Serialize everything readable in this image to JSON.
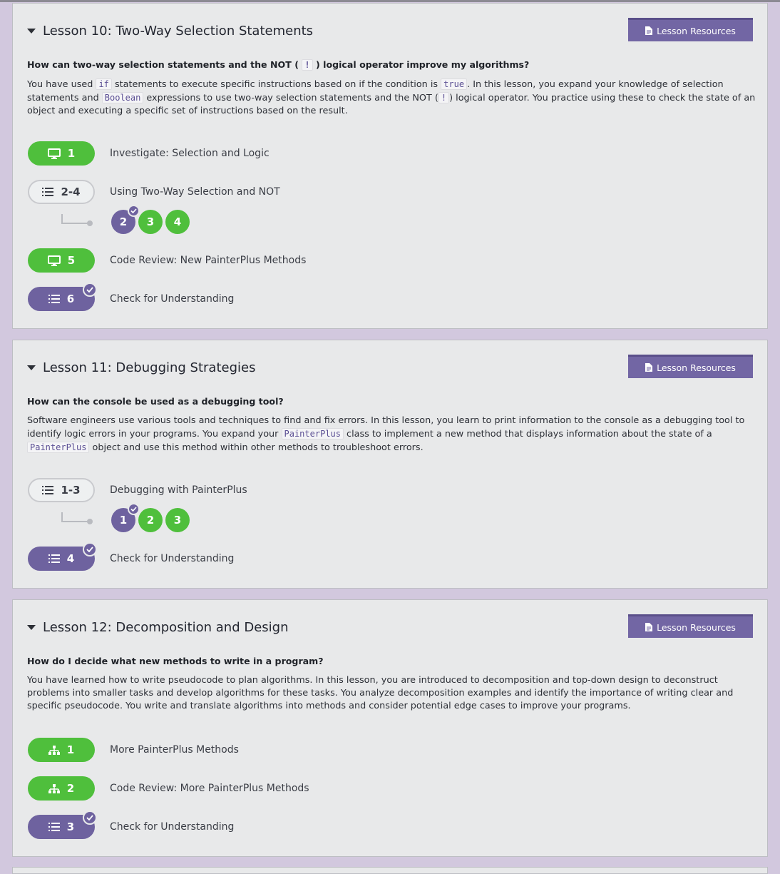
{
  "lessons": [
    {
      "title": "Lesson 10: Two-Way Selection Statements",
      "resources_label": "Lesson Resources",
      "question_before": "How can two-way selection statements and the NOT (",
      "question_code": "!",
      "question_after": ") logical operator improve my algorithms?",
      "desc": {
        "t1": "You have used ",
        "c1": "if",
        "t2": " statements to execute specific instructions based on if the condition is ",
        "c2": "true",
        "t3": ". In this lesson, you expand your knowledge of selection statements and ",
        "c3": "Boolean",
        "t4": " expressions to use two-way selection statements and the NOT (",
        "c4": "!",
        "t5": ") logical operator. You practice using these to check the state of an object and executing a specific set of instructions based on the result."
      },
      "activities": [
        {
          "number": "1",
          "label": "Investigate: Selection and Logic",
          "icon": "monitor-icon",
          "style": "green"
        },
        {
          "number": "2-4",
          "label": "Using Two-Way Selection and NOT",
          "icon": "list-icon",
          "style": "outline",
          "subs": [
            {
              "number": "2",
              "style": "purple",
              "checked": true
            },
            {
              "number": "3",
              "style": "green"
            },
            {
              "number": "4",
              "style": "green"
            }
          ]
        },
        {
          "number": "5",
          "label": "Code Review: New PainterPlus Methods",
          "icon": "monitor-icon",
          "style": "green"
        },
        {
          "number": "6",
          "label": "Check for Understanding",
          "icon": "list-icon",
          "style": "purple",
          "checked": true
        }
      ]
    },
    {
      "title": "Lesson 11: Debugging Strategies",
      "resources_label": "Lesson Resources",
      "question": "How can the console be used as a debugging tool?",
      "desc": {
        "t1": "Software engineers use various tools and techniques to find and fix errors. In this lesson, you learn to print information to the console as a debugging tool to identify logic errors in your programs. You expand your ",
        "c1": "PainterPlus",
        "t2": " class to implement a new method that displays information about the state of a ",
        "c2": "PainterPlus",
        "t3": " object and use this method within other methods to troubleshoot errors."
      },
      "activities": [
        {
          "number": "1-3",
          "label": "Debugging with PainterPlus",
          "icon": "list-icon",
          "style": "outline",
          "subs": [
            {
              "number": "1",
              "style": "purple",
              "checked": true
            },
            {
              "number": "2",
              "style": "green"
            },
            {
              "number": "3",
              "style": "green"
            }
          ]
        },
        {
          "number": "4",
          "label": "Check for Understanding",
          "icon": "list-icon",
          "style": "purple",
          "checked": true
        }
      ]
    },
    {
      "title": "Lesson 12: Decomposition and Design",
      "resources_label": "Lesson Resources",
      "question": "How do I decide what new methods to write in a program?",
      "desc": {
        "t1": "You have learned how to write pseudocode to plan algorithms. In this lesson, you are introduced to decomposition and top-down design to deconstruct problems into smaller tasks and develop algorithms for these tasks. You analyze decomposition examples and identify the importance of writing clear and specific pseudocode. You write and translate algorithms into methods and consider potential edge cases to improve your programs."
      },
      "activities": [
        {
          "number": "1",
          "label": "More PainterPlus Methods",
          "icon": "sitemap-icon",
          "style": "green"
        },
        {
          "number": "2",
          "label": "Code Review: More PainterPlus Methods",
          "icon": "sitemap-icon",
          "style": "green"
        },
        {
          "number": "3",
          "label": "Check for Understanding",
          "icon": "list-icon",
          "style": "purple",
          "checked": true
        }
      ]
    }
  ],
  "colors": {
    "page_bg": "#d2c8de",
    "card_bg": "#e8e9ea",
    "green": "#4fbf3c",
    "purple": "#6e629f",
    "button": "#7266a4"
  }
}
